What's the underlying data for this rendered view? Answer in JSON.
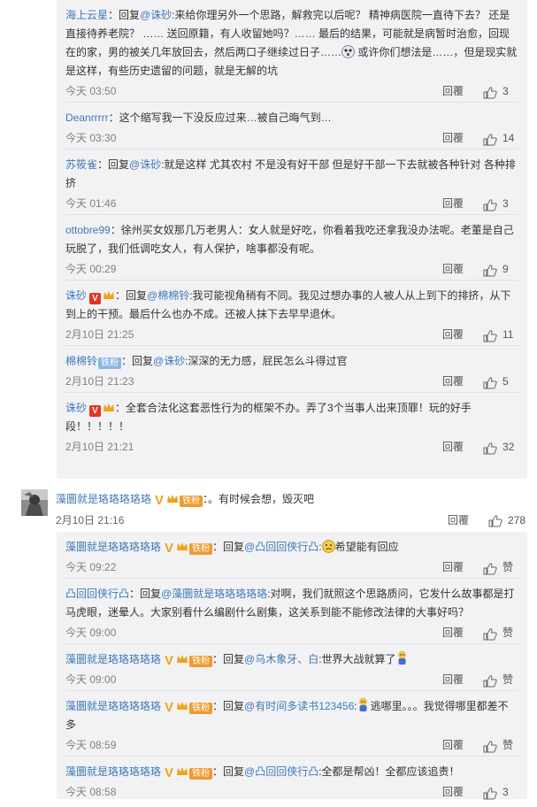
{
  "reply_label": "回覆",
  "colors": {
    "link": "#3e79b7",
    "panel_bg": "#f2f2f5",
    "red_badge": "#e8321f",
    "gold": "#f0a31a"
  },
  "group1": [
    {
      "user": "海上云星",
      "pre": "：回复",
      "mention": "@诛砂",
      "text": ":来给你理另外一个思路，解救完以后呢？ 精神病医院一直待下去？ 还是直接待养老院？ …… 送回原籍，有人收留她吗？…… 最后的结果，可能就是病暂时治愈，回现在的家，男的被关几年放回去，然后两口子继续过日子……",
      "emoji": "shocked-emoji",
      "text2": " 或许你们想法是……，但是现实就是这样，有些历史遗留的问题，就是无解的坑",
      "time": "今天 03:50",
      "likes": "3"
    },
    {
      "user": "Deanrrrrr",
      "text": "：这个缩写我一下没反应过来…被自己晦气到…",
      "time": "今天 03:30",
      "likes": "14"
    },
    {
      "user": "苏筱雀",
      "pre": "：回复",
      "mention": "@诛砂",
      "text": ":就是这样 尤其农村 不是没有好干部 但是好干部一下去就被各种针对 各种排挤",
      "time": "今天 01:46",
      "likes": "3"
    },
    {
      "user": "ottobre99",
      "text": "：徐州买女奴那几万老男人：女人就是好吃，你看着我吃还拿我没办法呢。老董是自己玩脱了，我们低调吃女人，有人保护，啥事都没有呢。",
      "time": "今天 00:29",
      "likes": "9"
    },
    {
      "user": "诛砂",
      "pre": "：回复",
      "mention": "@棉棉铃",
      "text": ":我可能视角稍有不同。我见过想办事的人被人从上到下的排挤，从下到上的干预。最后什么也办不成。还被人抹下去早早退休。",
      "time": "2月10日 21:25",
      "likes": "11"
    },
    {
      "user": "棉棉铃",
      "badge": "铁粉",
      "pre": "：回复",
      "mention": "@诛砂",
      "text": ":深深的无力感，屁民怎么斗得过官",
      "time": "2月10日 21:23",
      "likes": "5"
    },
    {
      "user": "诛砂",
      "text": "：全套合法化这套恶性行为的框架不办。弄了3个当事人出来顶罪！玩的好手段！！！！！",
      "time": "2月10日 21:21",
      "likes": "32"
    }
  ],
  "top_comment": {
    "user": "藻圜就是珞珞珞珞珞",
    "badge": "铁粉",
    "text": "：。有时候会想，毁灭吧",
    "time": "2月10日 21:16",
    "likes": "278"
  },
  "group2": [
    {
      "user": "藻圜就是珞珞珞珞珞",
      "badge": "铁粉",
      "pre": "：回复",
      "mention": "@凸回回侠行凸",
      "text": ":",
      "emoji": "sad-emoji",
      "text2": "希望能有回应",
      "time": "今天 09:22",
      "likes": "赞"
    },
    {
      "user": "凸回回侠行凸",
      "pre": "：回复",
      "mention": "@藻圜就是珞珞珞珞珞",
      "text": ":对啊，我们就照这个思路质问，它发什么故事都是打马虎眼，迷晕人。大家别看什么编剧什么剧集，这关系到能不能修改法律的大事好吗？",
      "time": "今天 09:00",
      "likes": "赞"
    },
    {
      "user": "藻圜就是珞珞珞珞珞",
      "badge": "铁粉",
      "pre": "：回复",
      "mention": "@乌木象牙、白",
      "text": ":世界大战就算了",
      "emoji": "doll-emoji",
      "time": "今天 09:00",
      "likes": "赞"
    },
    {
      "user": "藻圜就是珞珞珞珞珞",
      "badge": "铁粉",
      "pre": "：回复",
      "mention": "@有时间多读书123456",
      "text": ":",
      "emoji": "doll-emoji",
      "text2": "逃哪里。。。我觉得哪里都差不多",
      "time": "今天 08:59",
      "likes": "赞"
    },
    {
      "user": "藻圜就是珞珞珞珞珞",
      "badge": "铁粉",
      "pre": "：回复",
      "mention": "@凸回回侠行凸",
      "text": ":全都是帮凶！全都应该追责！",
      "time": "今天 08:58",
      "likes": "3"
    }
  ]
}
